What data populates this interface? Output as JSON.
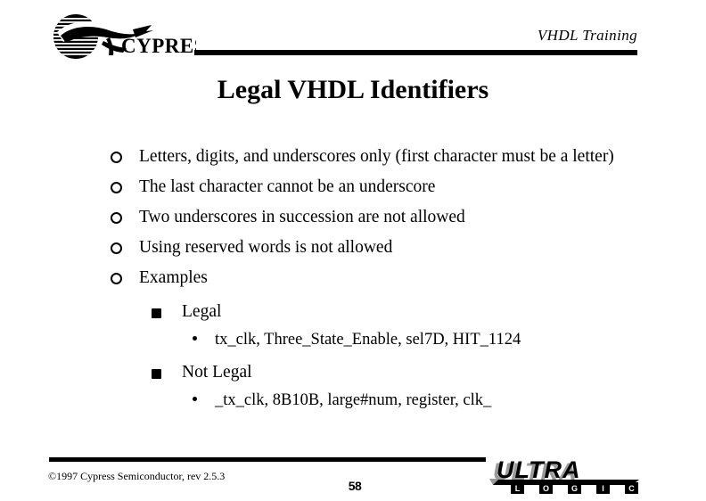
{
  "header": {
    "title": "VHDL Training",
    "logo_name": "cypress-logo",
    "logo_text": "CYPRESS"
  },
  "slide": {
    "title": "Legal VHDL Identifiers"
  },
  "bullets": [
    {
      "level": 1,
      "marker": "ring-bullet",
      "text": "Letters, digits, and underscores only (first character must be a letter)"
    },
    {
      "level": 1,
      "marker": "ring-bullet",
      "text": "The last character cannot be an underscore"
    },
    {
      "level": 1,
      "marker": "ring-bullet",
      "text": "Two underscores in succession are not allowed"
    },
    {
      "level": 1,
      "marker": "ring-bullet",
      "text": "Using reserved words is not allowed"
    },
    {
      "level": 1,
      "marker": "ring-bullet",
      "text": "Examples"
    },
    {
      "level": 2,
      "marker": "square-bullet",
      "text": "Legal"
    },
    {
      "level": 3,
      "marker": "dot-bullet",
      "text": "tx_clk, Three_State_Enable, sel7D, HIT_1124"
    },
    {
      "level": 2,
      "marker": "square-bullet",
      "text": "Not Legal"
    },
    {
      "level": 3,
      "marker": "dot-bullet",
      "text": "_tx_clk, 8B10B, large#num, register, clk_"
    }
  ],
  "footer": {
    "copyright": "©1997 Cypress Semiconductor, rev 2.5.3",
    "page_number": "58",
    "logo_primary": "ULTRA",
    "logo_secondary": [
      "L",
      "O",
      "G",
      "I",
      "C"
    ],
    "logo_shadow_color": "#9a9a9a",
    "logo_color": "#000000"
  },
  "colors": {
    "background": "#ffffff",
    "text": "#000000",
    "rule": "#000000"
  }
}
